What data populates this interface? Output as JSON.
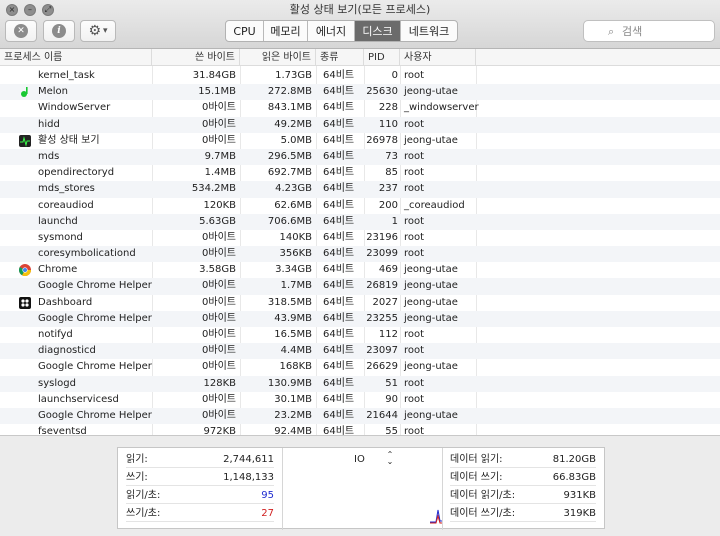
{
  "window": {
    "title": "활성 상태 보기(모든 프로세스)"
  },
  "toolbar": {
    "close_glyph": "✕",
    "info_glyph": "i",
    "gear_glyph": "⚙",
    "gear_caret": "▾"
  },
  "tabs": [
    "CPU",
    "메모리",
    "에너지",
    "디스크",
    "네트워크"
  ],
  "active_tab": "디스크",
  "search": {
    "placeholder": "검색",
    "icon": "search-icon"
  },
  "columns": [
    "프로세스 이름",
    "쓴 바이트",
    "읽은 바이트",
    "종류",
    "PID",
    "사용자"
  ],
  "rows": [
    {
      "name": "kernel_task",
      "written": "31.84GB",
      "read": "1.73GB",
      "kind": "64비트",
      "pid": "0",
      "user": "root",
      "icon": ""
    },
    {
      "name": "Melon",
      "written": "15.1MB",
      "read": "272.8MB",
      "kind": "64비트",
      "pid": "25630",
      "user": "jeong-utae",
      "icon": "melon-icon"
    },
    {
      "name": "WindowServer",
      "written": "0바이트",
      "read": "843.1MB",
      "kind": "64비트",
      "pid": "228",
      "user": "_windowserver",
      "icon": ""
    },
    {
      "name": "hidd",
      "written": "0바이트",
      "read": "49.2MB",
      "kind": "64비트",
      "pid": "110",
      "user": "root",
      "icon": ""
    },
    {
      "name": "활성 상태 보기",
      "written": "0바이트",
      "read": "5.0MB",
      "kind": "64비트",
      "pid": "26978",
      "user": "jeong-utae",
      "icon": "activity-monitor-icon"
    },
    {
      "name": "mds",
      "written": "9.7MB",
      "read": "296.5MB",
      "kind": "64비트",
      "pid": "73",
      "user": "root",
      "icon": ""
    },
    {
      "name": "opendirectoryd",
      "written": "1.4MB",
      "read": "692.7MB",
      "kind": "64비트",
      "pid": "85",
      "user": "root",
      "icon": ""
    },
    {
      "name": "mds_stores",
      "written": "534.2MB",
      "read": "4.23GB",
      "kind": "64비트",
      "pid": "237",
      "user": "root",
      "icon": ""
    },
    {
      "name": "coreaudiod",
      "written": "120KB",
      "read": "62.6MB",
      "kind": "64비트",
      "pid": "200",
      "user": "_coreaudiod",
      "icon": ""
    },
    {
      "name": "launchd",
      "written": "5.63GB",
      "read": "706.6MB",
      "kind": "64비트",
      "pid": "1",
      "user": "root",
      "icon": ""
    },
    {
      "name": "sysmond",
      "written": "0바이트",
      "read": "140KB",
      "kind": "64비트",
      "pid": "23196",
      "user": "root",
      "icon": ""
    },
    {
      "name": "coresymbolicationd",
      "written": "0바이트",
      "read": "356KB",
      "kind": "64비트",
      "pid": "23099",
      "user": "root",
      "icon": ""
    },
    {
      "name": "Chrome",
      "written": "3.58GB",
      "read": "3.34GB",
      "kind": "64비트",
      "pid": "469",
      "user": "jeong-utae",
      "icon": "chrome-icon"
    },
    {
      "name": "Google Chrome Helper",
      "written": "0바이트",
      "read": "1.7MB",
      "kind": "64비트",
      "pid": "26819",
      "user": "jeong-utae",
      "icon": ""
    },
    {
      "name": "Dashboard",
      "written": "0바이트",
      "read": "318.5MB",
      "kind": "64비트",
      "pid": "2027",
      "user": "jeong-utae",
      "icon": "dashboard-icon"
    },
    {
      "name": "Google Chrome Helper",
      "written": "0바이트",
      "read": "43.9MB",
      "kind": "64비트",
      "pid": "23255",
      "user": "jeong-utae",
      "icon": ""
    },
    {
      "name": "notifyd",
      "written": "0바이트",
      "read": "16.5MB",
      "kind": "64비트",
      "pid": "112",
      "user": "root",
      "icon": ""
    },
    {
      "name": "diagnosticd",
      "written": "0바이트",
      "read": "4.4MB",
      "kind": "64비트",
      "pid": "23097",
      "user": "root",
      "icon": ""
    },
    {
      "name": "Google Chrome Helper",
      "written": "0바이트",
      "read": "168KB",
      "kind": "64비트",
      "pid": "26629",
      "user": "jeong-utae",
      "icon": ""
    },
    {
      "name": "syslogd",
      "written": "128KB",
      "read": "130.9MB",
      "kind": "64비트",
      "pid": "51",
      "user": "root",
      "icon": ""
    },
    {
      "name": "launchservicesd",
      "written": "0바이트",
      "read": "30.1MB",
      "kind": "64비트",
      "pid": "90",
      "user": "root",
      "icon": ""
    },
    {
      "name": "Google Chrome Helper",
      "written": "0바이트",
      "read": "23.2MB",
      "kind": "64비트",
      "pid": "21644",
      "user": "jeong-utae",
      "icon": ""
    },
    {
      "name": "fseventsd",
      "written": "972KB",
      "read": "92.4MB",
      "kind": "64비트",
      "pid": "55",
      "user": "root",
      "icon": ""
    }
  ],
  "stats_left": [
    {
      "label": "읽기:",
      "value": "2,744,611",
      "color": "#222222"
    },
    {
      "label": "쓰기:",
      "value": "1,148,133",
      "color": "#222222"
    },
    {
      "label": "읽기/초:",
      "value": "95",
      "color": "#1f2bd0"
    },
    {
      "label": "쓰기/초:",
      "value": "27",
      "color": "#d01f1f"
    }
  ],
  "graph": {
    "mode_label": "IO",
    "mode_arrows": "⌃⌄",
    "read_color": "#1f2bd0",
    "write_color": "#d01f1f"
  },
  "stats_right": [
    {
      "label": "데이터 읽기:",
      "value": "81.20GB"
    },
    {
      "label": "데이터 쓰기:",
      "value": "66.83GB"
    },
    {
      "label": "데이터 읽기/초:",
      "value": "931KB"
    },
    {
      "label": "데이터 쓰기/초:",
      "value": "319KB"
    }
  ]
}
